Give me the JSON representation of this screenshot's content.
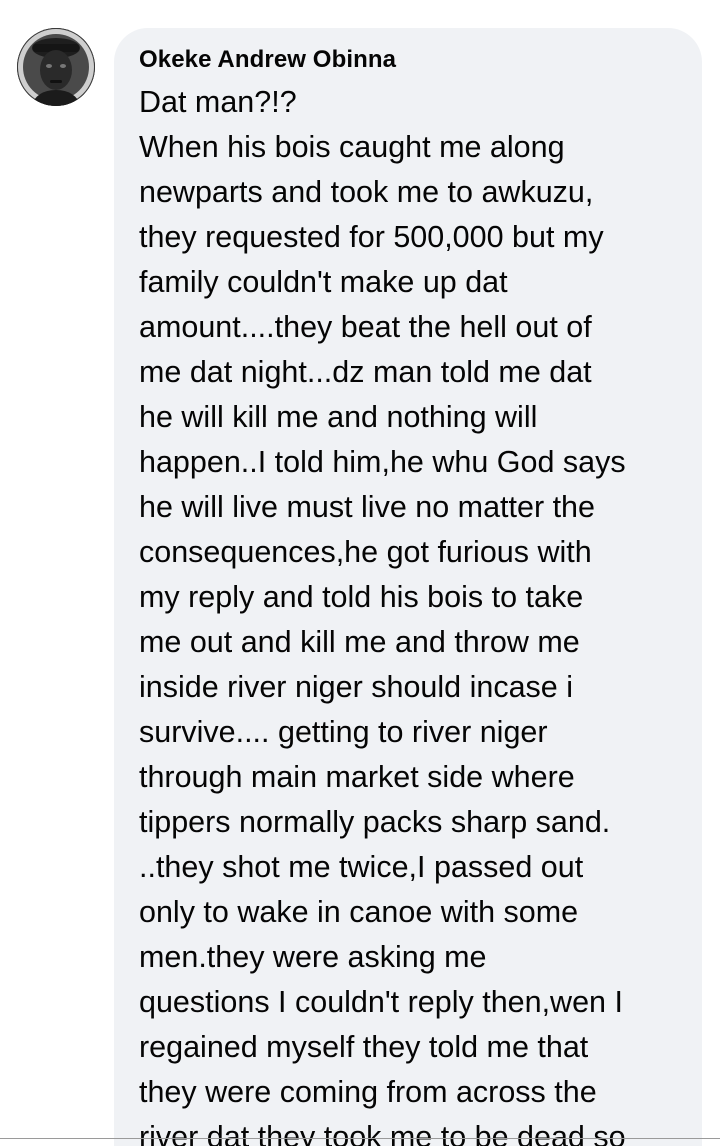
{
  "comment": {
    "author": "Okeke Andrew Obinna",
    "lines": [
      "Dat man?!?",
      "When his bois caught me along",
      "newparts and took me to awkuzu,",
      "they requested for 500,000 but my",
      "family couldn't make up dat",
      "amount....they beat the hell out of",
      "me dat night...dz man told me dat",
      "he will kill me and nothing will",
      "happen..I told him,he whu God says",
      "he will live must live no matter the",
      "consequences,he got furious with",
      "my reply and told his bois to take",
      "me out and kill me and throw me",
      "inside river niger should incase i",
      "survive.... getting to river niger",
      "through main market side where",
      "tippers normally packs sharp sand.",
      "..they shot me twice,I passed out",
      "only to wake in canoe with some",
      "men.they were asking me",
      "questions I couldn't reply then,wen I",
      "regained myself they told me that",
      "they were coming from across the",
      "river dat they took me to be dead so"
    ]
  },
  "colors": {
    "bubble_background": "#f0f2f5",
    "text": "#050505"
  }
}
